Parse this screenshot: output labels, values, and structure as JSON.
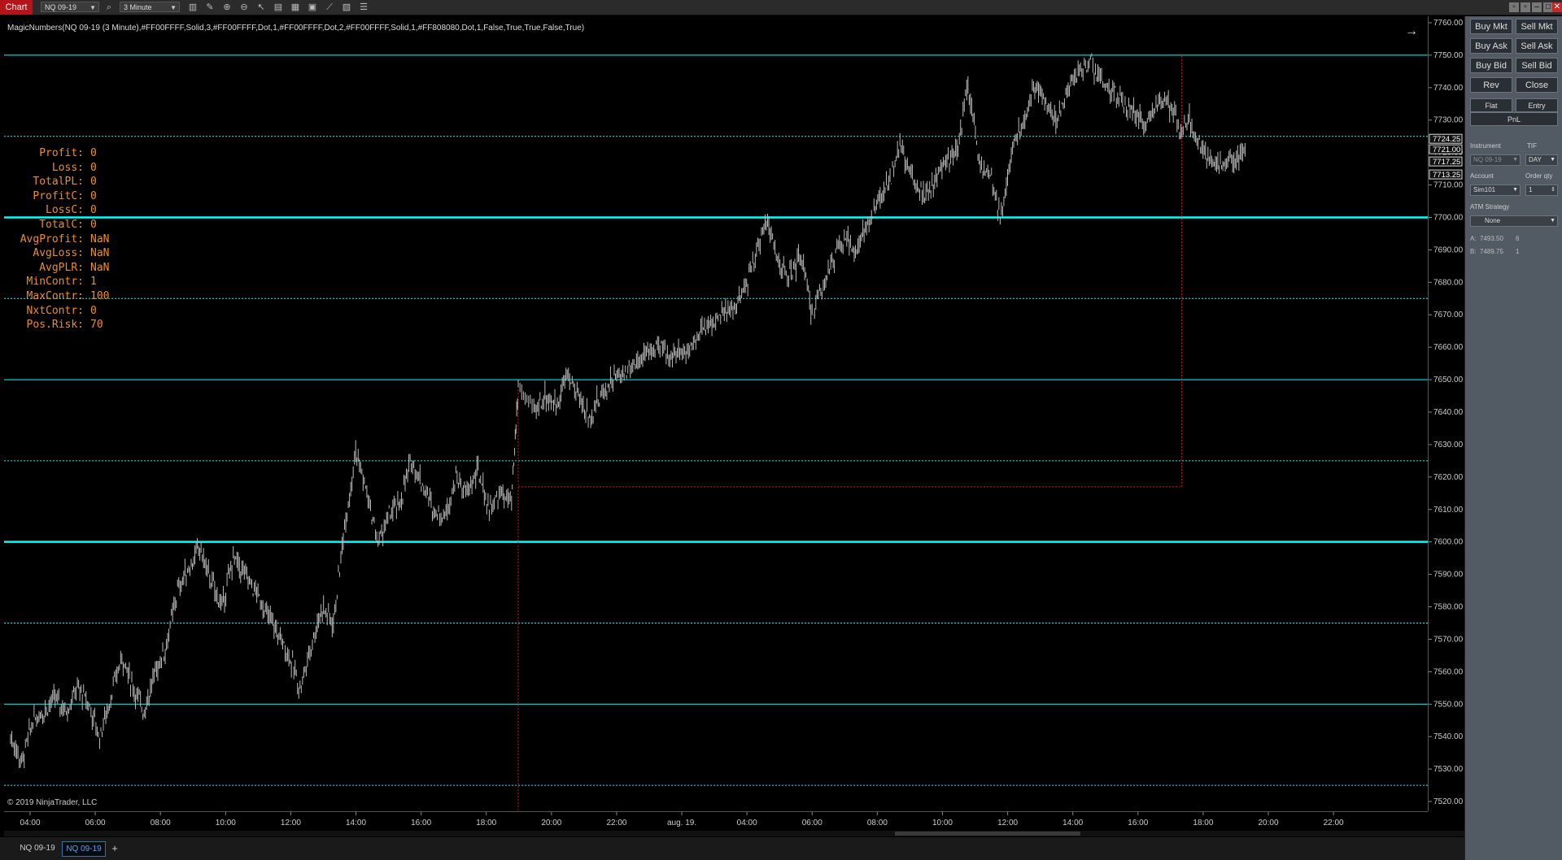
{
  "toolbar": {
    "chart_tab": "Chart",
    "instrument": "NQ 09-19",
    "interval": "3 Minute"
  },
  "chart": {
    "indicator_label": "MagicNumbers(NQ 09-19 (3 Minute),#FF00FFFF,Solid,3,#FF00FFFF,Dot,1,#FF00FFFF,Dot,2,#FF00FFFF,Solid,1,#FF808080,Dot,1,False,True,True,False,True)",
    "copyright": "© 2019 NinjaTrader, LLC",
    "stats": [
      {
        "label": "Profit:",
        "value": "0"
      },
      {
        "label": "Loss:",
        "value": "0"
      },
      {
        "label": "TotalPL:",
        "value": "0"
      },
      {
        "label": "ProfitC:",
        "value": "0"
      },
      {
        "label": "LossC:",
        "value": "0"
      },
      {
        "label": "TotalC:",
        "value": "0"
      },
      {
        "label": "AvgProfit:",
        "value": "NaN"
      },
      {
        "label": "AvgLoss:",
        "value": "NaN"
      },
      {
        "label": "AvgPLR:",
        "value": "NaN"
      },
      {
        "label": "MinContr:",
        "value": "1"
      },
      {
        "label": "MaxContr:",
        "value": "100"
      },
      {
        "label": "NxtContr:",
        "value": "0"
      },
      {
        "label": "Pos.Risk:",
        "value": "70"
      }
    ]
  },
  "chart_data": {
    "type": "candlestick",
    "y_ticks": [
      "7760.00",
      "7750.00",
      "7740.00",
      "7730.00",
      "7720.00",
      "7710.00",
      "7700.00",
      "7690.00",
      "7680.00",
      "7670.00",
      "7660.00",
      "7650.00",
      "7640.00",
      "7630.00",
      "7620.00",
      "7610.00",
      "7600.00",
      "7590.00",
      "7580.00",
      "7570.00",
      "7560.00",
      "7550.00",
      "7540.00",
      "7530.00",
      "7520.00"
    ],
    "ylim": [
      7517,
      7762
    ],
    "x_ticks": [
      "04:00",
      "06:00",
      "08:00",
      "10:00",
      "12:00",
      "14:00",
      "16:00",
      "18:00",
      "20:00",
      "22:00",
      "aug. 19.",
      "04:00",
      "06:00",
      "08:00",
      "10:00",
      "12:00",
      "14:00",
      "16:00",
      "18:00",
      "20:00",
      "22:00"
    ],
    "price_markers": [
      "7724.25",
      "7721.00",
      "7717.25",
      "7713.25"
    ],
    "level_lines": [
      {
        "price": 7750,
        "style": "solid"
      },
      {
        "price": 7725,
        "style": "dot"
      },
      {
        "price": 7700,
        "style": "solid-thick"
      },
      {
        "price": 7675,
        "style": "dot"
      },
      {
        "price": 7650,
        "style": "solid"
      },
      {
        "price": 7625,
        "style": "dot"
      },
      {
        "price": 7600,
        "style": "solid-thick"
      },
      {
        "price": 7575,
        "style": "dot"
      },
      {
        "price": 7550,
        "style": "solid"
      },
      {
        "price": 7525,
        "style": "dot"
      }
    ],
    "price_path": [
      [
        0,
        7540
      ],
      [
        0.5,
        7532
      ],
      [
        1,
        7545
      ],
      [
        1.5,
        7548
      ],
      [
        2,
        7552
      ],
      [
        2.5,
        7548
      ],
      [
        3,
        7555
      ],
      [
        3.5,
        7550
      ],
      [
        4,
        7540
      ],
      [
        4.5,
        7552
      ],
      [
        5,
        7565
      ],
      [
        5.5,
        7555
      ],
      [
        6,
        7548
      ],
      [
        6.5,
        7560
      ],
      [
        7,
        7568
      ],
      [
        7.5,
        7585
      ],
      [
        8,
        7592
      ],
      [
        8.5,
        7598
      ],
      [
        9,
        7588
      ],
      [
        9.5,
        7580
      ],
      [
        10,
        7595
      ],
      [
        10.5,
        7590
      ],
      [
        11,
        7585
      ],
      [
        11.5,
        7578
      ],
      [
        12,
        7572
      ],
      [
        12.5,
        7565
      ],
      [
        13,
        7555
      ],
      [
        13.5,
        7568
      ],
      [
        14,
        7580
      ],
      [
        14.5,
        7575
      ],
      [
        15,
        7605
      ],
      [
        15.5,
        7628
      ],
      [
        16,
        7615
      ],
      [
        16.5,
        7600
      ],
      [
        17,
        7608
      ],
      [
        17.5,
        7612
      ],
      [
        18,
        7625
      ],
      [
        18.5,
        7618
      ],
      [
        19,
        7610
      ],
      [
        19.5,
        7608
      ],
      [
        20,
        7620
      ],
      [
        20.5,
        7615
      ],
      [
        21,
        7622
      ],
      [
        21.5,
        7610
      ],
      [
        22,
        7615
      ],
      [
        22.5,
        7612
      ],
      [
        22.8,
        7648
      ],
      [
        23.5,
        7640
      ],
      [
        24,
        7645
      ],
      [
        24.5,
        7642
      ],
      [
        25,
        7652
      ],
      [
        25.5,
        7645
      ],
      [
        26,
        7638
      ],
      [
        26.5,
        7645
      ],
      [
        27,
        7650
      ],
      [
        27.5,
        7652
      ],
      [
        28,
        7655
      ],
      [
        28.5,
        7658
      ],
      [
        29,
        7660
      ],
      [
        29.5,
        7658
      ],
      [
        30,
        7658
      ],
      [
        30.5,
        7660
      ],
      [
        31,
        7665
      ],
      [
        31.5,
        7668
      ],
      [
        32,
        7670
      ],
      [
        32.5,
        7672
      ],
      [
        33,
        7678
      ],
      [
        33.5,
        7690
      ],
      [
        34,
        7700
      ],
      [
        34.5,
        7685
      ],
      [
        35,
        7682
      ],
      [
        35.5,
        7688
      ],
      [
        36,
        7670
      ],
      [
        36.5,
        7680
      ],
      [
        37,
        7688
      ],
      [
        37.5,
        7693
      ],
      [
        38,
        7690
      ],
      [
        38.5,
        7698
      ],
      [
        39,
        7705
      ],
      [
        39.5,
        7712
      ],
      [
        40,
        7722
      ],
      [
        40.5,
        7712
      ],
      [
        41,
        7708
      ],
      [
        41.5,
        7710
      ],
      [
        42,
        7718
      ],
      [
        42.5,
        7720
      ],
      [
        43,
        7742
      ],
      [
        43.5,
        7718
      ],
      [
        44,
        7712
      ],
      [
        44.5,
        7700
      ],
      [
        45,
        7722
      ],
      [
        45.5,
        7730
      ],
      [
        46,
        7742
      ],
      [
        46.5,
        7735
      ],
      [
        47,
        7730
      ],
      [
        47.5,
        7740
      ],
      [
        48,
        7745
      ],
      [
        48.5,
        7748
      ],
      [
        49,
        7742
      ],
      [
        49.5,
        7738
      ],
      [
        50,
        7735
      ],
      [
        50.5,
        7732
      ],
      [
        51,
        7728
      ],
      [
        51.5,
        7736
      ],
      [
        52,
        7735
      ],
      [
        52.5,
        7728
      ],
      [
        53,
        7730
      ],
      [
        53.5,
        7720
      ],
      [
        54,
        7718
      ],
      [
        54.5,
        7715
      ],
      [
        55,
        7718
      ],
      [
        55.5,
        7722
      ]
    ],
    "x_span": [
      0,
      57
    ],
    "grid": false
  },
  "panel": {
    "buttons": {
      "buy_mkt": "Buy Mkt",
      "sell_mkt": "Sell Mkt",
      "buy_ask": "Buy Ask",
      "sell_ask": "Sell Ask",
      "buy_bid": "Buy Bid",
      "sell_bid": "Sell Bid",
      "rev": "Rev",
      "close": "Close",
      "flat": "Flat",
      "entry": "Entry",
      "pnl": "PnL"
    },
    "labels": {
      "instrument": "Instrument",
      "tif": "TIF",
      "account": "Account",
      "order_qty": "Order qty",
      "atm_strategy": "ATM Strategy"
    },
    "fields": {
      "instrument": "NQ 09-19",
      "tif": "DAY",
      "account": "Sim101",
      "order_qty": "1",
      "atm_strategy": "None"
    },
    "quotes": {
      "ask_label": "A:",
      "ask_price": "7493.50",
      "ask_size": "6",
      "bid_label": "B:",
      "bid_price": "7489.75",
      "bid_size": "1"
    }
  },
  "tabs": {
    "tab1": "NQ 09-19",
    "tab2": "NQ 09-19",
    "add": "+"
  },
  "colors": {
    "level": "#00ffff",
    "candle": "#bbbbbb",
    "stats_text": "#ef8f1f",
    "stop_line": "#cc1111",
    "panel_bg": "#525a63"
  }
}
